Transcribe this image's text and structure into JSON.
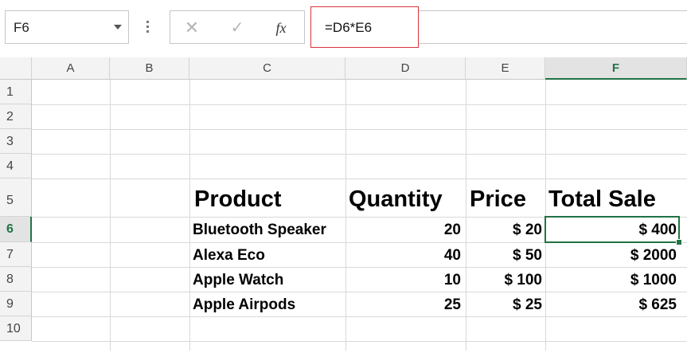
{
  "formula_bar": {
    "name_box": "F6",
    "cancel_icon": "✕",
    "enter_icon": "✓",
    "fx_label": "fx",
    "formula": "=D6*E6"
  },
  "columns": [
    "A",
    "B",
    "C",
    "D",
    "E",
    "F"
  ],
  "rows": [
    "1",
    "2",
    "3",
    "4",
    "5",
    "6",
    "7",
    "8",
    "9",
    "10"
  ],
  "table": {
    "headers": {
      "product": "Product",
      "quantity": "Quantity",
      "price": "Price",
      "total": "Total Sale"
    },
    "rows": [
      {
        "product": "Bluetooth Speaker",
        "quantity": "20",
        "price": "$ 20",
        "total": "$ 400"
      },
      {
        "product": "Alexa Eco",
        "quantity": "40",
        "price": "$ 50",
        "total": "$ 2000"
      },
      {
        "product": "Apple Watch",
        "quantity": "10",
        "price": "$ 100",
        "total": "$ 1000"
      },
      {
        "product": "Apple Airpods",
        "quantity": "25",
        "price": "$ 25",
        "total": "$ 625"
      }
    ]
  },
  "active_cell": "F6",
  "colors": {
    "accent": "#217346",
    "highlight_border": "#d9333a"
  }
}
